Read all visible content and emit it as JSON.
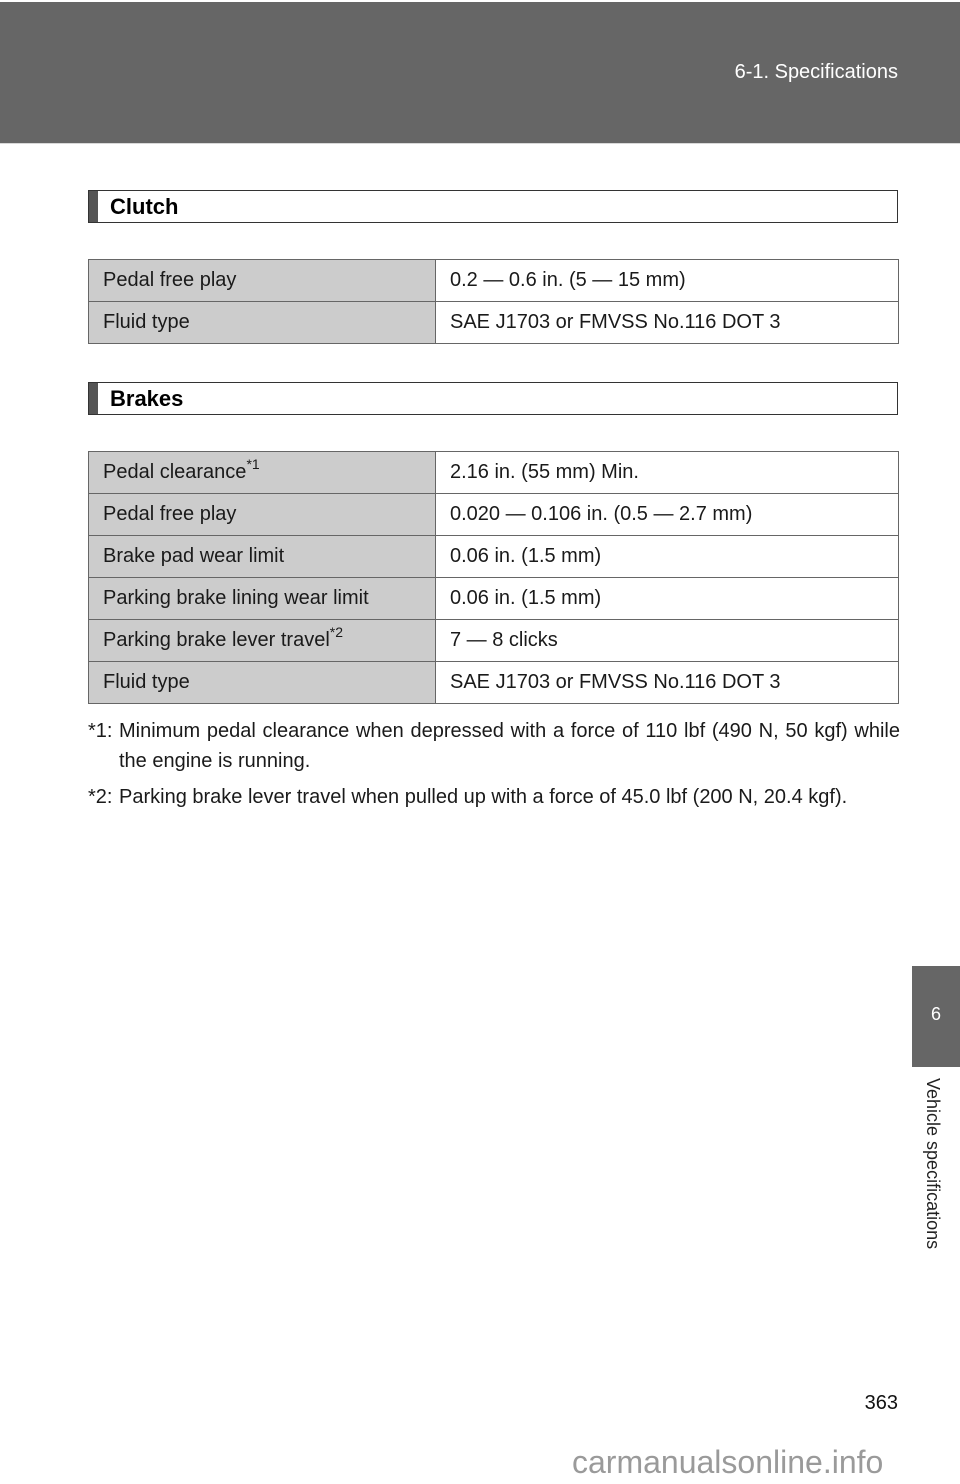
{
  "header": {
    "section_title": "6-1. Specifications"
  },
  "clutch": {
    "title": "Clutch",
    "rows": [
      {
        "label": "Pedal free play",
        "value": "0.2 — 0.6 in. (5 — 15 mm)"
      },
      {
        "label": "Fluid type",
        "value": "SAE J1703 or FMVSS No.116 DOT 3"
      }
    ]
  },
  "brakes": {
    "title": "Brakes",
    "rows": [
      {
        "label": "Pedal clearance",
        "footnote_ref": "*1",
        "value": "2.16 in. (55 mm) Min."
      },
      {
        "label": "Pedal free play",
        "value": "0.020 — 0.106 in. (0.5 — 2.7 mm)"
      },
      {
        "label": "Brake pad wear limit",
        "value": "0.06 in. (1.5 mm)"
      },
      {
        "label": "Parking brake lining wear limit",
        "value": "0.06 in. (1.5 mm)"
      },
      {
        "label": "Parking brake lever travel",
        "footnote_ref": "*2",
        "value": "7 — 8 clicks"
      },
      {
        "label": "Fluid type",
        "value": "SAE J1703 or FMVSS No.116 DOT 3"
      }
    ]
  },
  "footnotes": [
    {
      "mark": "*1:",
      "text": "Minimum pedal clearance when depressed with a force of 110 lbf (490 N, 50 kgf) while the engine is running."
    },
    {
      "mark": "*2:",
      "text": "Parking brake lever travel when pulled up with a force of 45.0 lbf (200 N, 20.4 kgf)."
    }
  ],
  "side_tab": {
    "number": "6",
    "label": "Vehicle specifications"
  },
  "page_number": "363",
  "watermark": "carmanualsonline.info"
}
